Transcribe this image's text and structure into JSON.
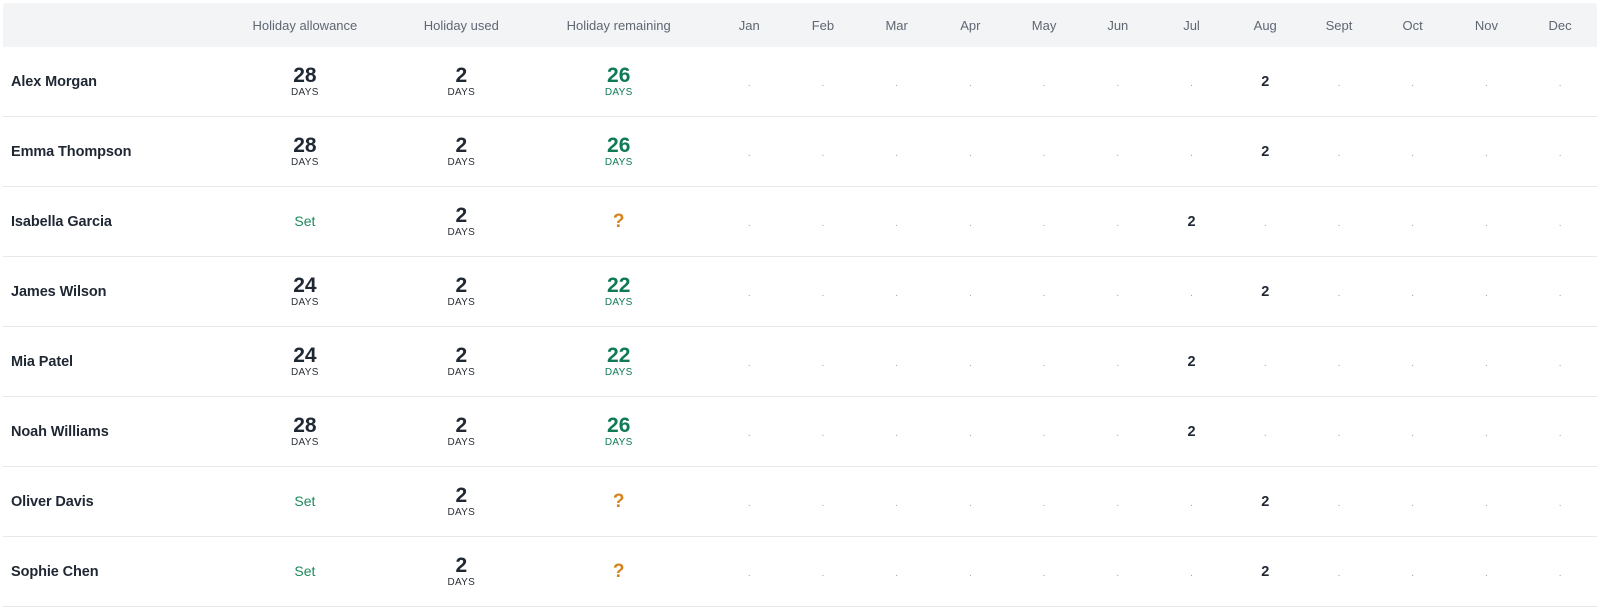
{
  "headers": {
    "allowance": "Holiday allowance",
    "used": "Holiday used",
    "remaining": "Holiday remaining",
    "months": [
      "Jan",
      "Feb",
      "Mar",
      "Apr",
      "May",
      "Jun",
      "Jul",
      "Aug",
      "Sept",
      "Oct",
      "Nov",
      "Dec"
    ]
  },
  "unit_label": "DAYS",
  "set_label": "Set",
  "unknown_label": "?",
  "empty_label": ".",
  "colors": {
    "remaining": "#0f7a55",
    "set_link": "#1d8a5c",
    "unknown": "#d4831a",
    "header_bg": "#f2f4f6"
  },
  "rows": [
    {
      "name": "Alex Morgan",
      "allowance": "28",
      "used": "2",
      "remaining": "26",
      "months": [
        "",
        "",
        "",
        "",
        "",
        "",
        "",
        "2",
        "",
        "",
        "",
        ""
      ]
    },
    {
      "name": "Emma Thompson",
      "allowance": "28",
      "used": "2",
      "remaining": "26",
      "months": [
        "",
        "",
        "",
        "",
        "",
        "",
        "",
        "2",
        "",
        "",
        "",
        ""
      ]
    },
    {
      "name": "Isabella Garcia",
      "allowance": null,
      "used": "2",
      "remaining": null,
      "months": [
        "",
        "",
        "",
        "",
        "",
        "",
        "2",
        "",
        "",
        "",
        "",
        ""
      ]
    },
    {
      "name": "James Wilson",
      "allowance": "24",
      "used": "2",
      "remaining": "22",
      "months": [
        "",
        "",
        "",
        "",
        "",
        "",
        "",
        "2",
        "",
        "",
        "",
        ""
      ]
    },
    {
      "name": "Mia Patel",
      "allowance": "24",
      "used": "2",
      "remaining": "22",
      "months": [
        "",
        "",
        "",
        "",
        "",
        "",
        "2",
        "",
        "",
        "",
        "",
        ""
      ]
    },
    {
      "name": "Noah Williams",
      "allowance": "28",
      "used": "2",
      "remaining": "26",
      "months": [
        "",
        "",
        "",
        "",
        "",
        "",
        "2",
        "",
        "",
        "",
        "",
        ""
      ]
    },
    {
      "name": "Oliver Davis",
      "allowance": null,
      "used": "2",
      "remaining": null,
      "months": [
        "",
        "",
        "",
        "",
        "",
        "",
        "",
        "2",
        "",
        "",
        "",
        ""
      ]
    },
    {
      "name": "Sophie Chen",
      "allowance": null,
      "used": "2",
      "remaining": null,
      "months": [
        "",
        "",
        "",
        "",
        "",
        "",
        "",
        "2",
        "",
        "",
        "",
        ""
      ]
    }
  ]
}
